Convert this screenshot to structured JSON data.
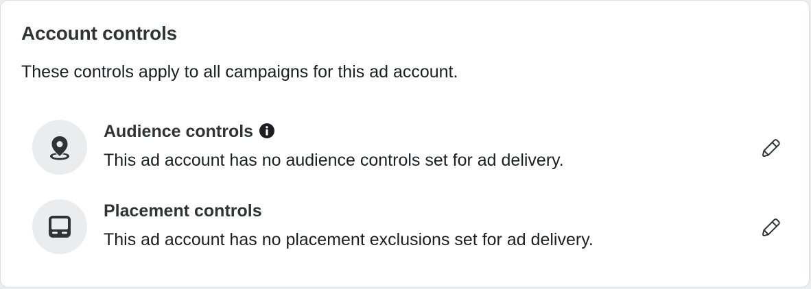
{
  "section": {
    "title": "Account controls",
    "subtitle": "These controls apply to all campaigns for this ad account."
  },
  "controls": [
    {
      "title": "Audience controls",
      "description": "This ad account has no audience controls set for ad delivery.",
      "icon": "location-pin-icon",
      "has_info": true
    },
    {
      "title": "Placement controls",
      "description": "This ad account has no placement exclusions set for ad delivery.",
      "icon": "device-screen-icon",
      "has_info": false
    }
  ],
  "colors": {
    "icon": "#303235",
    "icon_bg": "#ebecee",
    "text": "#1c1e21"
  }
}
